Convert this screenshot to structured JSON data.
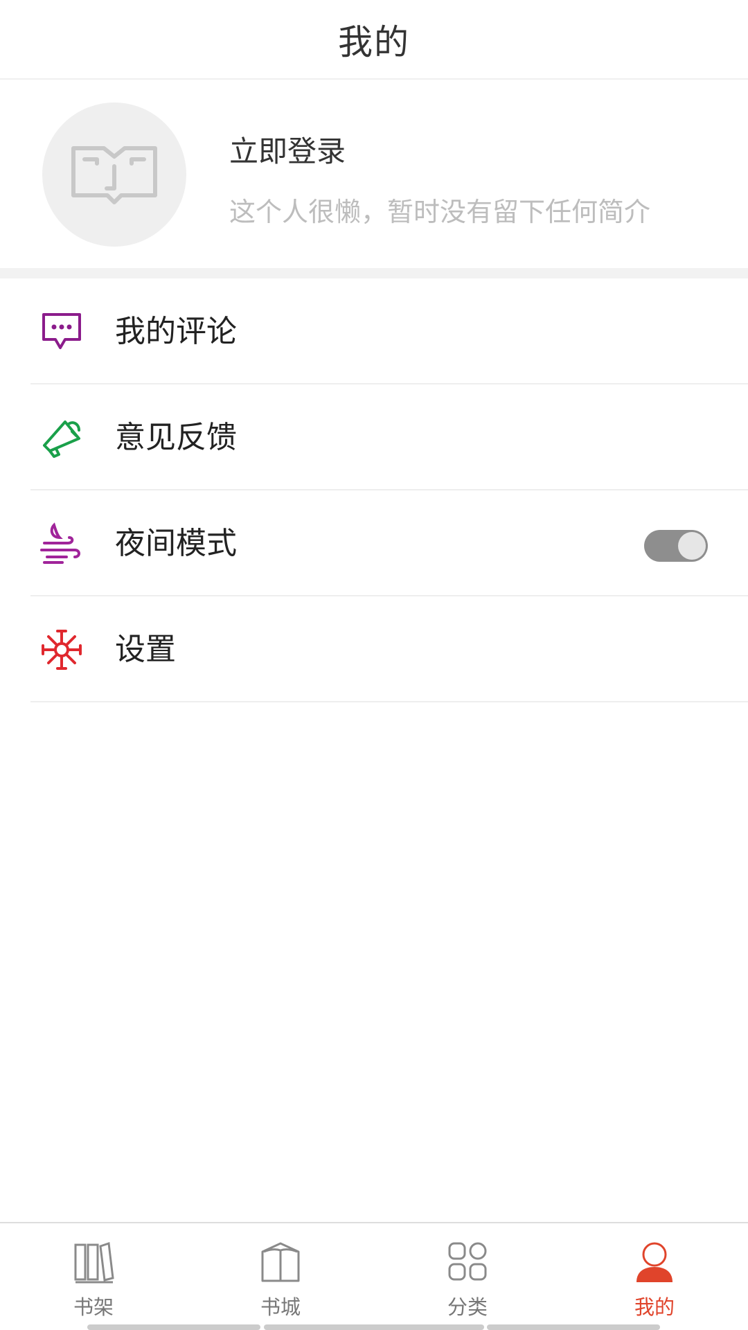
{
  "header": {
    "title": "我的"
  },
  "profile": {
    "login_label": "立即登录",
    "bio": "这个人很懒，暂时没有留下任何简介"
  },
  "menu": {
    "items": [
      {
        "label": "我的评论",
        "icon": "comment-bubble-icon",
        "color": "#8b1c8b"
      },
      {
        "label": "意见反馈",
        "icon": "megaphone-icon",
        "color": "#1aa04a"
      },
      {
        "label": "夜间模式",
        "icon": "night-moon-wind-icon",
        "color": "#a0249a",
        "toggle": true,
        "toggle_on": false
      },
      {
        "label": "设置",
        "icon": "gear-icon",
        "color": "#e0282e"
      }
    ]
  },
  "tabbar": {
    "tabs": [
      {
        "label": "书架",
        "icon": "bookshelf-icon",
        "active": false
      },
      {
        "label": "书城",
        "icon": "open-book-icon",
        "active": false
      },
      {
        "label": "分类",
        "icon": "grid-icon",
        "active": false
      },
      {
        "label": "我的",
        "icon": "user-icon",
        "active": true
      }
    ],
    "active_color": "#e0442b",
    "inactive_color": "#777777"
  }
}
